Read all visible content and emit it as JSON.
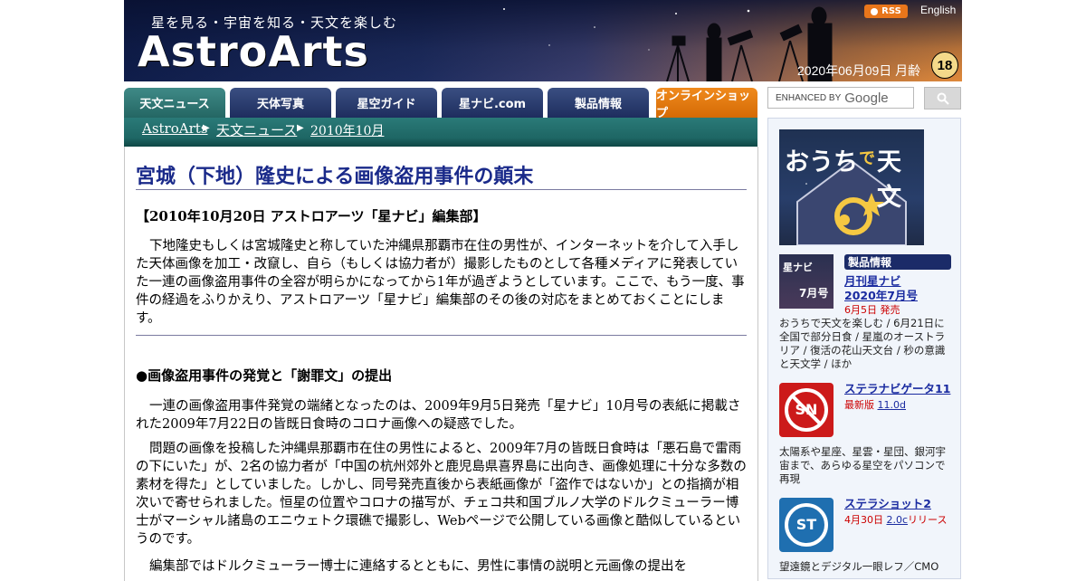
{
  "header": {
    "tagline": "星を見る・宇宙を知る・天文を楽しむ",
    "logo": "AstroArts",
    "rss_label": "RSS",
    "english_label": "English",
    "date": "2020年06月09日 月齢",
    "moon_age": "18"
  },
  "nav": {
    "tabs": [
      {
        "label": "天文ニュース"
      },
      {
        "label": "天体写真"
      },
      {
        "label": "星空ガイド"
      },
      {
        "label": "星ナビ.com"
      },
      {
        "label": "製品情報"
      },
      {
        "label": "オンラインショップ"
      }
    ]
  },
  "breadcrumb": {
    "items": [
      "AstroArts",
      "天文ニュース",
      "2010年10月"
    ]
  },
  "article": {
    "title": "宮城（下地）隆史による画像盗用事件の顛末",
    "byline": "【2010年10月20日 アストロアーツ「星ナビ」編集部】",
    "intro": "下地隆史もしくは宮城隆史と称していた沖縄県那覇市在住の男性が、インターネットを介して入手した天体画像を加工・改竄し、自ら（もしくは協力者が）撮影したものとして各種メディアに発表していた一連の画像盗用事件の全容が明らかになってから1年が過ぎようとしています。ここで、もう一度、事件の経過をふりかえり、アストロアーツ「星ナビ」編集部のその後の対応をまとめておくことにします。",
    "section1": "●画像盗用事件の発覚と「謝罪文」の提出",
    "p1": "一連の画像盗用事件発覚の端緒となったのは、2009年9月5日発売「星ナビ」10月号の表紙に掲載された2009年7月22日の皆既日食時のコロナ画像への疑惑でした。",
    "p2": "問題の画像を投稿した沖縄県那覇市在住の男性によると、2009年7月の皆既日食時は「悪石島で雷雨の下にいた」が、2名の協力者が「中国の杭州郊外と鹿児島県喜界島に出向き、画像処理に十分な多数の素材を得た」としていました。しかし、同号発売直後から表紙画像が「盗作ではないか」との指摘が相次いで寄せられました。恒星の位置やコロナの描写が、チェコ共和国ブルノ大学のドルクミューラー博士がマーシャル諸島のエニウェトク環礁で撮影し、Webページで公開している画像と酷似しているというのです。",
    "p3": "編集部ではドルクミューラー博士に連絡するとともに、男性に事情の説明と元画像の提出を"
  },
  "search": {
    "placeholder": "ENHANCE BY Google",
    "prefix": "ENHANCED BY",
    "brand": "Google"
  },
  "sidebar": {
    "banner_text": "おうちで天文",
    "banner_line1": "おうち",
    "banner_line2": "天文",
    "banner_de": "で",
    "section_header": "製品情報",
    "products": [
      {
        "title_line1": "月刊星ナビ",
        "title_line2": "2020年7月号",
        "meta": "6月5日 発売",
        "desc": "おうちで天文を楽しむ / 6月21日に全国で部分日食 / 星嵐のオーストラリア / 復活の花山天文台 / 秒の意識と天文学 / ほか",
        "thumb_label": "星ナビ",
        "thumb_sub": "7月号"
      },
      {
        "title_line1": "ステラナビゲータ11",
        "meta_prefix": "最新版 ",
        "meta_version": "11.0d",
        "desc": "太陽系や星座、星雲・星団、銀河宇宙まで、あらゆる星空をパソコンで再現",
        "thumb_label": "SN"
      },
      {
        "title_line1": "ステラショット2",
        "meta_prefix": "4月30日 ",
        "meta_version": "2.0c",
        "meta_suffix": "リリース",
        "desc": "望遠鏡とデジタル一眼レフ／CMO",
        "thumb_label": "ST"
      }
    ]
  },
  "colors": {
    "nav_tab": "#1e2d5e",
    "nav_active": "#246663",
    "nav_shop": "#d46a05",
    "title": "#1a2a8a",
    "link": "#1a2ba0",
    "red_meta": "#cc0000"
  }
}
